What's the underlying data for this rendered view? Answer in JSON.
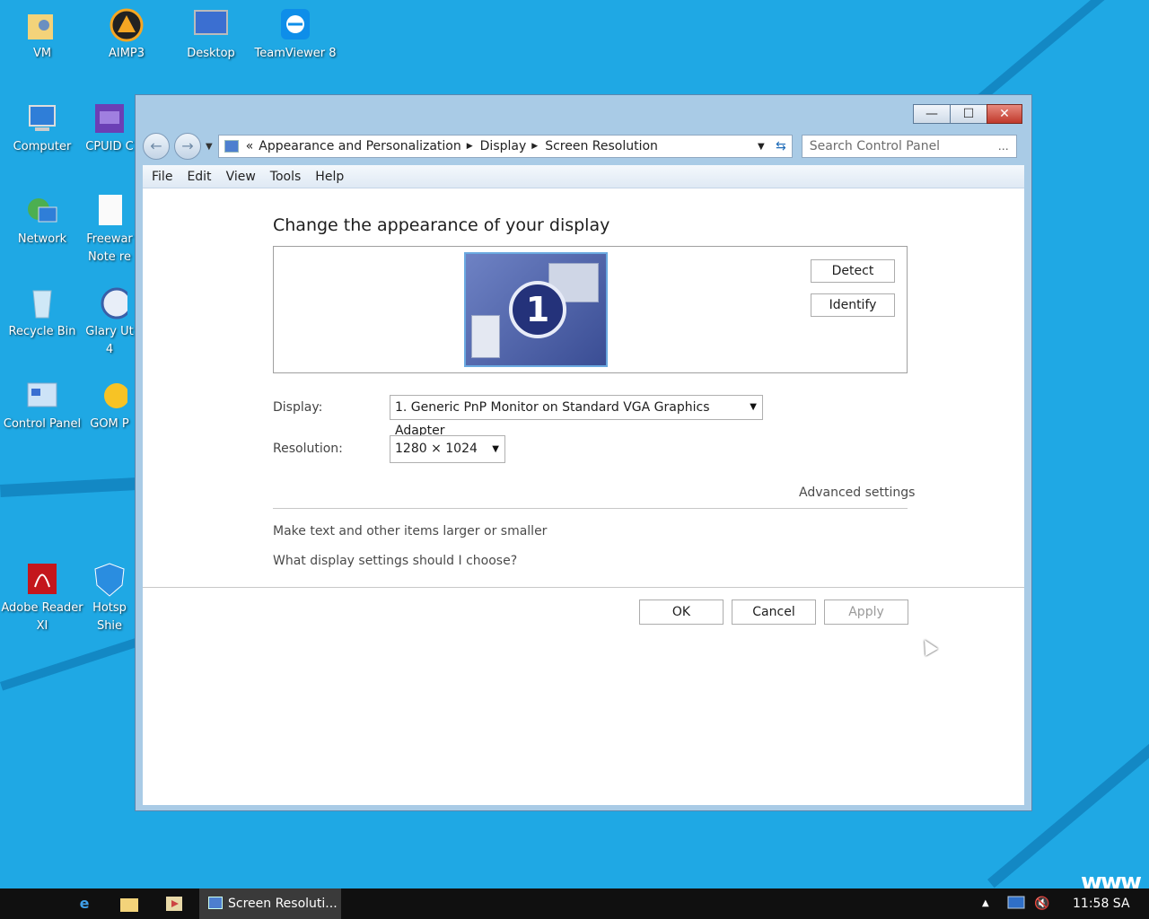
{
  "desktop": {
    "icons": [
      {
        "label": "VM"
      },
      {
        "label": "AIMP3"
      },
      {
        "label": "Desktop"
      },
      {
        "label": "TeamViewer 8"
      },
      {
        "label": "Computer"
      },
      {
        "label": "CPUID C"
      },
      {
        "label": "Network"
      },
      {
        "label": "Freewar Note re"
      },
      {
        "label": "Recycle Bin"
      },
      {
        "label": "Glary Ut 4"
      },
      {
        "label": "Control Panel"
      },
      {
        "label": "GOM P"
      },
      {
        "label": "Adobe Reader XI"
      },
      {
        "label": "Hotsp Shie"
      }
    ],
    "watermark": "www"
  },
  "window": {
    "controls": {
      "minimize": "—",
      "maximize": "☐",
      "close": "✕"
    },
    "address": {
      "prefix": "«",
      "crumbs": [
        "Appearance and Personalization",
        "Display",
        "Screen Resolution"
      ]
    },
    "search": {
      "placeholder": "Search Control Panel"
    },
    "menu": [
      "File",
      "Edit",
      "View",
      "Tools",
      "Help"
    ]
  },
  "content": {
    "heading": "Change the appearance of your display",
    "monitor_number": "1",
    "detect_label": "Detect",
    "identify_label": "Identify",
    "display_label": "Display:",
    "display_value": "1. Generic PnP Monitor on Standard VGA Graphics Adapter",
    "resolution_label": "Resolution:",
    "resolution_value": "1280 × 1024",
    "advanced_settings": "Advanced settings",
    "link_text_size": "Make text and other items larger or smaller",
    "link_which_settings": "What display settings should I choose?",
    "ok_label": "OK",
    "cancel_label": "Cancel",
    "apply_label": "Apply"
  },
  "taskbar": {
    "task_label": "Screen Resoluti...",
    "clock": "11:58 SA"
  }
}
